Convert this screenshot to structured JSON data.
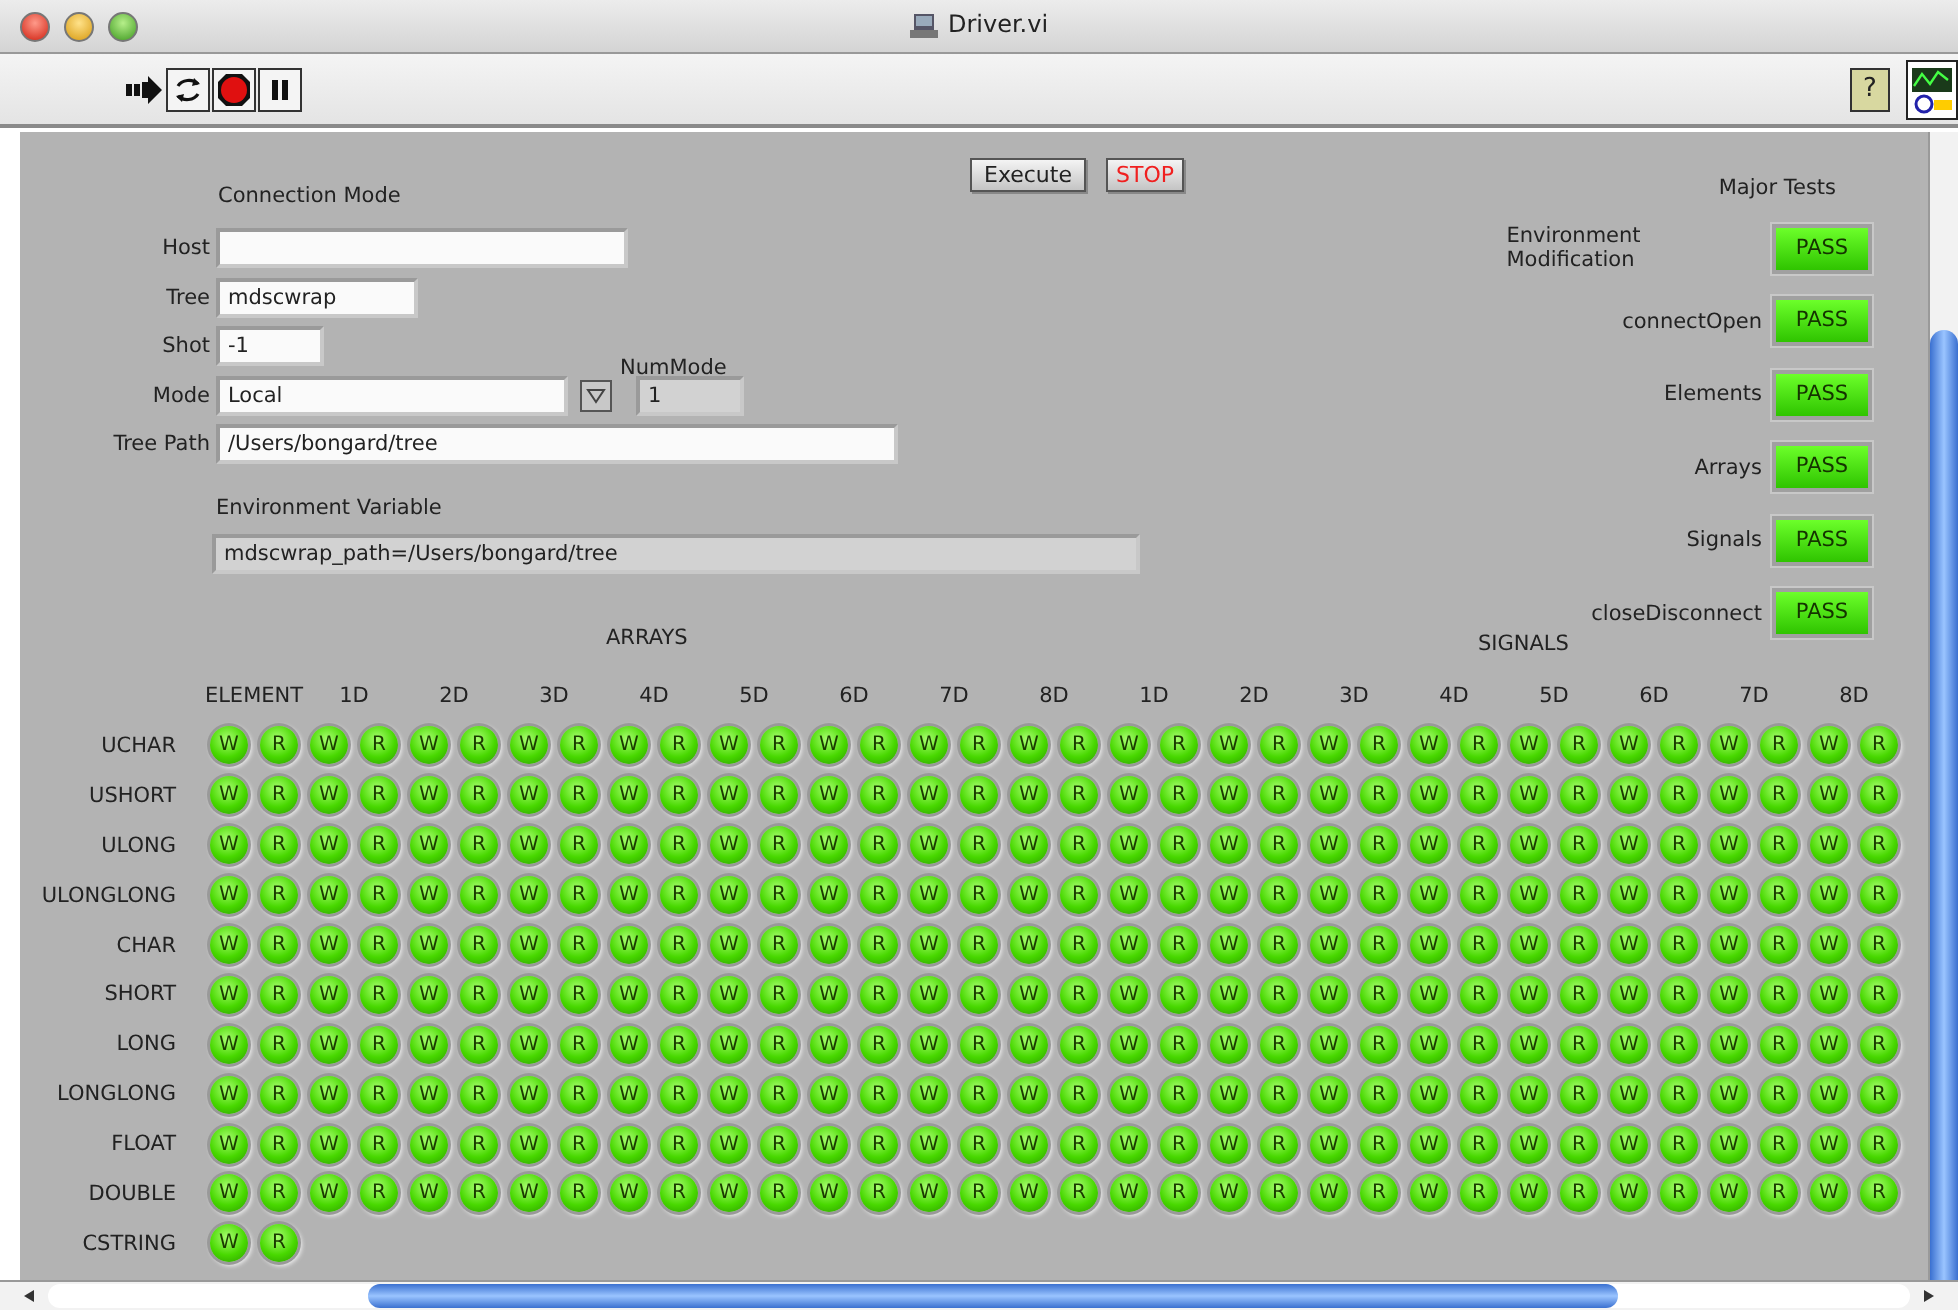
{
  "window": {
    "title": "Driver.vi"
  },
  "toolbar": {
    "help": "?"
  },
  "connection_mode": {
    "heading": "Connection Mode",
    "host": {
      "label": "Host"
    },
    "tree": {
      "label": "Tree",
      "value": "mdscwrap"
    },
    "shot": {
      "label": "Shot",
      "value": "-1"
    },
    "mode": {
      "label": "Mode",
      "value": "Local"
    },
    "num_mode": {
      "label": "NumMode",
      "value": "1"
    },
    "tree_path": {
      "label": "Tree Path",
      "value": "/Users/bongard/tree"
    },
    "environment_variable": {
      "label": "Environment Variable",
      "value": "mdscwrap_path=/Users/bongard/tree"
    }
  },
  "buttons": [
    {
      "label": "Execute",
      "kind": "normal"
    },
    {
      "label": "STOP",
      "kind": "stop"
    }
  ],
  "major_tests": {
    "heading": "Major Tests",
    "tests": [
      {
        "name": "Environment Modification",
        "result": "PASS",
        "on": true
      },
      {
        "name": "connectOpen",
        "result": "PASS",
        "on": true
      },
      {
        "name": "Elements",
        "result": "PASS",
        "on": true
      },
      {
        "name": "Arrays",
        "result": "PASS",
        "on": true
      },
      {
        "name": "Signals",
        "result": "PASS",
        "on": true
      },
      {
        "name": "closeDisconnect",
        "result": "PASS",
        "on": true
      }
    ]
  },
  "grid": {
    "groups": [
      "ARRAYS",
      "SIGNALS"
    ],
    "columns": [
      "ELEMENT",
      "1D",
      "2D",
      "3D",
      "4D",
      "5D",
      "6D",
      "7D",
      "8D",
      "1D",
      "2D",
      "3D",
      "4D",
      "5D",
      "6D",
      "7D",
      "8D"
    ],
    "rows": [
      {
        "name": "UCHAR",
        "leds": [
          {
            "label": "W",
            "on": true
          },
          {
            "label": "R",
            "on": true
          },
          {
            "label": "W",
            "on": true
          },
          {
            "label": "R",
            "on": true
          },
          {
            "label": "W",
            "on": true
          },
          {
            "label": "R",
            "on": true
          },
          {
            "label": "W",
            "on": true
          },
          {
            "label": "R",
            "on": true
          },
          {
            "label": "W",
            "on": true
          },
          {
            "label": "R",
            "on": true
          },
          {
            "label": "W",
            "on": true
          },
          {
            "label": "R",
            "on": true
          },
          {
            "label": "W",
            "on": true
          },
          {
            "label": "R",
            "on": true
          },
          {
            "label": "W",
            "on": true
          },
          {
            "label": "R",
            "on": true
          },
          {
            "label": "W",
            "on": true
          },
          {
            "label": "R",
            "on": true
          },
          {
            "label": "W",
            "on": true
          },
          {
            "label": "R",
            "on": true
          },
          {
            "label": "W",
            "on": true
          },
          {
            "label": "R",
            "on": true
          },
          {
            "label": "W",
            "on": true
          },
          {
            "label": "R",
            "on": true
          },
          {
            "label": "W",
            "on": true
          },
          {
            "label": "R",
            "on": true
          },
          {
            "label": "W",
            "on": true
          },
          {
            "label": "R",
            "on": true
          },
          {
            "label": "W",
            "on": true
          },
          {
            "label": "R",
            "on": true
          },
          {
            "label": "W",
            "on": true
          },
          {
            "label": "R",
            "on": true
          },
          {
            "label": "W",
            "on": true
          },
          {
            "label": "R",
            "on": true
          }
        ]
      },
      {
        "name": "USHORT",
        "leds": [
          {
            "label": "W",
            "on": true
          },
          {
            "label": "R",
            "on": true
          },
          {
            "label": "W",
            "on": true
          },
          {
            "label": "R",
            "on": true
          },
          {
            "label": "W",
            "on": true
          },
          {
            "label": "R",
            "on": true
          },
          {
            "label": "W",
            "on": true
          },
          {
            "label": "R",
            "on": true
          },
          {
            "label": "W",
            "on": true
          },
          {
            "label": "R",
            "on": true
          },
          {
            "label": "W",
            "on": true
          },
          {
            "label": "R",
            "on": true
          },
          {
            "label": "W",
            "on": true
          },
          {
            "label": "R",
            "on": true
          },
          {
            "label": "W",
            "on": true
          },
          {
            "label": "R",
            "on": true
          },
          {
            "label": "W",
            "on": true
          },
          {
            "label": "R",
            "on": true
          },
          {
            "label": "W",
            "on": true
          },
          {
            "label": "R",
            "on": true
          },
          {
            "label": "W",
            "on": true
          },
          {
            "label": "R",
            "on": true
          },
          {
            "label": "W",
            "on": true
          },
          {
            "label": "R",
            "on": true
          },
          {
            "label": "W",
            "on": true
          },
          {
            "label": "R",
            "on": true
          },
          {
            "label": "W",
            "on": true
          },
          {
            "label": "R",
            "on": true
          },
          {
            "label": "W",
            "on": true
          },
          {
            "label": "R",
            "on": true
          },
          {
            "label": "W",
            "on": true
          },
          {
            "label": "R",
            "on": true
          },
          {
            "label": "W",
            "on": true
          },
          {
            "label": "R",
            "on": true
          }
        ]
      },
      {
        "name": "ULONG",
        "leds": [
          {
            "label": "W",
            "on": true
          },
          {
            "label": "R",
            "on": true
          },
          {
            "label": "W",
            "on": true
          },
          {
            "label": "R",
            "on": true
          },
          {
            "label": "W",
            "on": true
          },
          {
            "label": "R",
            "on": true
          },
          {
            "label": "W",
            "on": true
          },
          {
            "label": "R",
            "on": true
          },
          {
            "label": "W",
            "on": true
          },
          {
            "label": "R",
            "on": true
          },
          {
            "label": "W",
            "on": true
          },
          {
            "label": "R",
            "on": true
          },
          {
            "label": "W",
            "on": true
          },
          {
            "label": "R",
            "on": true
          },
          {
            "label": "W",
            "on": true
          },
          {
            "label": "R",
            "on": true
          },
          {
            "label": "W",
            "on": true
          },
          {
            "label": "R",
            "on": true
          },
          {
            "label": "W",
            "on": true
          },
          {
            "label": "R",
            "on": true
          },
          {
            "label": "W",
            "on": true
          },
          {
            "label": "R",
            "on": true
          },
          {
            "label": "W",
            "on": true
          },
          {
            "label": "R",
            "on": true
          },
          {
            "label": "W",
            "on": true
          },
          {
            "label": "R",
            "on": true
          },
          {
            "label": "W",
            "on": true
          },
          {
            "label": "R",
            "on": true
          },
          {
            "label": "W",
            "on": true
          },
          {
            "label": "R",
            "on": true
          },
          {
            "label": "W",
            "on": true
          },
          {
            "label": "R",
            "on": true
          },
          {
            "label": "W",
            "on": true
          },
          {
            "label": "R",
            "on": true
          }
        ]
      },
      {
        "name": "ULONGLONG",
        "leds": [
          {
            "label": "W",
            "on": true
          },
          {
            "label": "R",
            "on": true
          },
          {
            "label": "W",
            "on": true
          },
          {
            "label": "R",
            "on": true
          },
          {
            "label": "W",
            "on": true
          },
          {
            "label": "R",
            "on": true
          },
          {
            "label": "W",
            "on": true
          },
          {
            "label": "R",
            "on": true
          },
          {
            "label": "W",
            "on": true
          },
          {
            "label": "R",
            "on": true
          },
          {
            "label": "W",
            "on": true
          },
          {
            "label": "R",
            "on": true
          },
          {
            "label": "W",
            "on": true
          },
          {
            "label": "R",
            "on": true
          },
          {
            "label": "W",
            "on": true
          },
          {
            "label": "R",
            "on": true
          },
          {
            "label": "W",
            "on": true
          },
          {
            "label": "R",
            "on": true
          },
          {
            "label": "W",
            "on": true
          },
          {
            "label": "R",
            "on": true
          },
          {
            "label": "W",
            "on": true
          },
          {
            "label": "R",
            "on": true
          },
          {
            "label": "W",
            "on": true
          },
          {
            "label": "R",
            "on": true
          },
          {
            "label": "W",
            "on": true
          },
          {
            "label": "R",
            "on": true
          },
          {
            "label": "W",
            "on": true
          },
          {
            "label": "R",
            "on": true
          },
          {
            "label": "W",
            "on": true
          },
          {
            "label": "R",
            "on": true
          },
          {
            "label": "W",
            "on": true
          },
          {
            "label": "R",
            "on": true
          },
          {
            "label": "W",
            "on": true
          },
          {
            "label": "R",
            "on": true
          }
        ]
      },
      {
        "name": "CHAR",
        "leds": [
          {
            "label": "W",
            "on": true
          },
          {
            "label": "R",
            "on": true
          },
          {
            "label": "W",
            "on": true
          },
          {
            "label": "R",
            "on": true
          },
          {
            "label": "W",
            "on": true
          },
          {
            "label": "R",
            "on": true
          },
          {
            "label": "W",
            "on": true
          },
          {
            "label": "R",
            "on": true
          },
          {
            "label": "W",
            "on": true
          },
          {
            "label": "R",
            "on": true
          },
          {
            "label": "W",
            "on": true
          },
          {
            "label": "R",
            "on": true
          },
          {
            "label": "W",
            "on": true
          },
          {
            "label": "R",
            "on": true
          },
          {
            "label": "W",
            "on": true
          },
          {
            "label": "R",
            "on": true
          },
          {
            "label": "W",
            "on": true
          },
          {
            "label": "R",
            "on": true
          },
          {
            "label": "W",
            "on": true
          },
          {
            "label": "R",
            "on": true
          },
          {
            "label": "W",
            "on": true
          },
          {
            "label": "R",
            "on": true
          },
          {
            "label": "W",
            "on": true
          },
          {
            "label": "R",
            "on": true
          },
          {
            "label": "W",
            "on": true
          },
          {
            "label": "R",
            "on": true
          },
          {
            "label": "W",
            "on": true
          },
          {
            "label": "R",
            "on": true
          },
          {
            "label": "W",
            "on": true
          },
          {
            "label": "R",
            "on": true
          },
          {
            "label": "W",
            "on": true
          },
          {
            "label": "R",
            "on": true
          },
          {
            "label": "W",
            "on": true
          },
          {
            "label": "R",
            "on": true
          }
        ]
      },
      {
        "name": "SHORT",
        "leds": [
          {
            "label": "W",
            "on": true
          },
          {
            "label": "R",
            "on": true
          },
          {
            "label": "W",
            "on": true
          },
          {
            "label": "R",
            "on": true
          },
          {
            "label": "W",
            "on": true
          },
          {
            "label": "R",
            "on": true
          },
          {
            "label": "W",
            "on": true
          },
          {
            "label": "R",
            "on": true
          },
          {
            "label": "W",
            "on": true
          },
          {
            "label": "R",
            "on": true
          },
          {
            "label": "W",
            "on": true
          },
          {
            "label": "R",
            "on": true
          },
          {
            "label": "W",
            "on": true
          },
          {
            "label": "R",
            "on": true
          },
          {
            "label": "W",
            "on": true
          },
          {
            "label": "R",
            "on": true
          },
          {
            "label": "W",
            "on": true
          },
          {
            "label": "R",
            "on": true
          },
          {
            "label": "W",
            "on": true
          },
          {
            "label": "R",
            "on": true
          },
          {
            "label": "W",
            "on": true
          },
          {
            "label": "R",
            "on": true
          },
          {
            "label": "W",
            "on": true
          },
          {
            "label": "R",
            "on": true
          },
          {
            "label": "W",
            "on": true
          },
          {
            "label": "R",
            "on": true
          },
          {
            "label": "W",
            "on": true
          },
          {
            "label": "R",
            "on": true
          },
          {
            "label": "W",
            "on": true
          },
          {
            "label": "R",
            "on": true
          },
          {
            "label": "W",
            "on": true
          },
          {
            "label": "R",
            "on": true
          },
          {
            "label": "W",
            "on": true
          },
          {
            "label": "R",
            "on": true
          }
        ]
      },
      {
        "name": "LONG",
        "leds": [
          {
            "label": "W",
            "on": true
          },
          {
            "label": "R",
            "on": true
          },
          {
            "label": "W",
            "on": true
          },
          {
            "label": "R",
            "on": true
          },
          {
            "label": "W",
            "on": true
          },
          {
            "label": "R",
            "on": true
          },
          {
            "label": "W",
            "on": true
          },
          {
            "label": "R",
            "on": true
          },
          {
            "label": "W",
            "on": true
          },
          {
            "label": "R",
            "on": true
          },
          {
            "label": "W",
            "on": true
          },
          {
            "label": "R",
            "on": true
          },
          {
            "label": "W",
            "on": true
          },
          {
            "label": "R",
            "on": true
          },
          {
            "label": "W",
            "on": true
          },
          {
            "label": "R",
            "on": true
          },
          {
            "label": "W",
            "on": true
          },
          {
            "label": "R",
            "on": true
          },
          {
            "label": "W",
            "on": true
          },
          {
            "label": "R",
            "on": true
          },
          {
            "label": "W",
            "on": true
          },
          {
            "label": "R",
            "on": true
          },
          {
            "label": "W",
            "on": true
          },
          {
            "label": "R",
            "on": true
          },
          {
            "label": "W",
            "on": true
          },
          {
            "label": "R",
            "on": true
          },
          {
            "label": "W",
            "on": true
          },
          {
            "label": "R",
            "on": true
          },
          {
            "label": "W",
            "on": true
          },
          {
            "label": "R",
            "on": true
          },
          {
            "label": "W",
            "on": true
          },
          {
            "label": "R",
            "on": true
          },
          {
            "label": "W",
            "on": true
          },
          {
            "label": "R",
            "on": true
          }
        ]
      },
      {
        "name": "LONGLONG",
        "leds": [
          {
            "label": "W",
            "on": true
          },
          {
            "label": "R",
            "on": true
          },
          {
            "label": "W",
            "on": true
          },
          {
            "label": "R",
            "on": true
          },
          {
            "label": "W",
            "on": true
          },
          {
            "label": "R",
            "on": true
          },
          {
            "label": "W",
            "on": true
          },
          {
            "label": "R",
            "on": true
          },
          {
            "label": "W",
            "on": true
          },
          {
            "label": "R",
            "on": true
          },
          {
            "label": "W",
            "on": true
          },
          {
            "label": "R",
            "on": true
          },
          {
            "label": "W",
            "on": true
          },
          {
            "label": "R",
            "on": true
          },
          {
            "label": "W",
            "on": true
          },
          {
            "label": "R",
            "on": true
          },
          {
            "label": "W",
            "on": true
          },
          {
            "label": "R",
            "on": true
          },
          {
            "label": "W",
            "on": true
          },
          {
            "label": "R",
            "on": true
          },
          {
            "label": "W",
            "on": true
          },
          {
            "label": "R",
            "on": true
          },
          {
            "label": "W",
            "on": true
          },
          {
            "label": "R",
            "on": true
          },
          {
            "label": "W",
            "on": true
          },
          {
            "label": "R",
            "on": true
          },
          {
            "label": "W",
            "on": true
          },
          {
            "label": "R",
            "on": true
          },
          {
            "label": "W",
            "on": true
          },
          {
            "label": "R",
            "on": true
          },
          {
            "label": "W",
            "on": true
          },
          {
            "label": "R",
            "on": true
          },
          {
            "label": "W",
            "on": true
          },
          {
            "label": "R",
            "on": true
          }
        ]
      },
      {
        "name": "FLOAT",
        "leds": [
          {
            "label": "W",
            "on": true
          },
          {
            "label": "R",
            "on": true
          },
          {
            "label": "W",
            "on": true
          },
          {
            "label": "R",
            "on": true
          },
          {
            "label": "W",
            "on": true
          },
          {
            "label": "R",
            "on": true
          },
          {
            "label": "W",
            "on": true
          },
          {
            "label": "R",
            "on": true
          },
          {
            "label": "W",
            "on": true
          },
          {
            "label": "R",
            "on": true
          },
          {
            "label": "W",
            "on": true
          },
          {
            "label": "R",
            "on": true
          },
          {
            "label": "W",
            "on": true
          },
          {
            "label": "R",
            "on": true
          },
          {
            "label": "W",
            "on": true
          },
          {
            "label": "R",
            "on": true
          },
          {
            "label": "W",
            "on": true
          },
          {
            "label": "R",
            "on": true
          },
          {
            "label": "W",
            "on": true
          },
          {
            "label": "R",
            "on": true
          },
          {
            "label": "W",
            "on": true
          },
          {
            "label": "R",
            "on": true
          },
          {
            "label": "W",
            "on": true
          },
          {
            "label": "R",
            "on": true
          },
          {
            "label": "W",
            "on": true
          },
          {
            "label": "R",
            "on": true
          },
          {
            "label": "W",
            "on": true
          },
          {
            "label": "R",
            "on": true
          },
          {
            "label": "W",
            "on": true
          },
          {
            "label": "R",
            "on": true
          },
          {
            "label": "W",
            "on": true
          },
          {
            "label": "R",
            "on": true
          },
          {
            "label": "W",
            "on": true
          },
          {
            "label": "R",
            "on": true
          }
        ]
      },
      {
        "name": "DOUBLE",
        "leds": [
          {
            "label": "W",
            "on": true
          },
          {
            "label": "R",
            "on": true
          },
          {
            "label": "W",
            "on": true
          },
          {
            "label": "R",
            "on": true
          },
          {
            "label": "W",
            "on": true
          },
          {
            "label": "R",
            "on": true
          },
          {
            "label": "W",
            "on": true
          },
          {
            "label": "R",
            "on": true
          },
          {
            "label": "W",
            "on": true
          },
          {
            "label": "R",
            "on": true
          },
          {
            "label": "W",
            "on": true
          },
          {
            "label": "R",
            "on": true
          },
          {
            "label": "W",
            "on": true
          },
          {
            "label": "R",
            "on": true
          },
          {
            "label": "W",
            "on": true
          },
          {
            "label": "R",
            "on": true
          },
          {
            "label": "W",
            "on": true
          },
          {
            "label": "R",
            "on": true
          },
          {
            "label": "W",
            "on": true
          },
          {
            "label": "R",
            "on": true
          },
          {
            "label": "W",
            "on": true
          },
          {
            "label": "R",
            "on": true
          },
          {
            "label": "W",
            "on": true
          },
          {
            "label": "R",
            "on": true
          },
          {
            "label": "W",
            "on": true
          },
          {
            "label": "R",
            "on": true
          },
          {
            "label": "W",
            "on": true
          },
          {
            "label": "R",
            "on": true
          },
          {
            "label": "W",
            "on": true
          },
          {
            "label": "R",
            "on": true
          },
          {
            "label": "W",
            "on": true
          },
          {
            "label": "R",
            "on": true
          },
          {
            "label": "W",
            "on": true
          },
          {
            "label": "R",
            "on": true
          }
        ]
      },
      {
        "name": "CSTRING",
        "leds": [
          {
            "label": "W",
            "on": true
          },
          {
            "label": "R",
            "on": true
          }
        ]
      }
    ]
  }
}
